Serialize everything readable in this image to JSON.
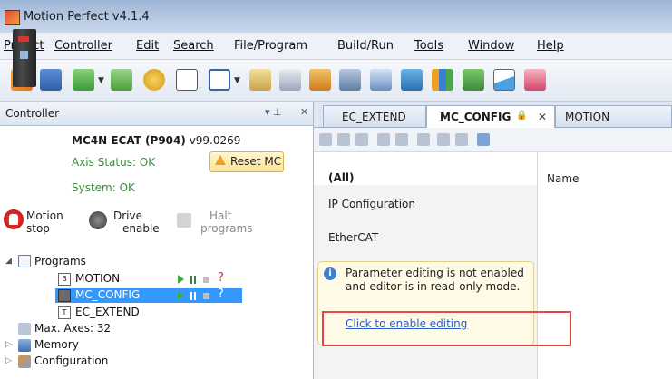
{
  "window": {
    "title": "Motion Perfect v4.1.4"
  },
  "menu": [
    "Project",
    "Controller",
    "Edit",
    "Search",
    "File/Program",
    "Build/Run",
    "Tools",
    "Window",
    "Help"
  ],
  "toolbar_icons": [
    "start-icon",
    "save-icon",
    "connect-icon",
    "dropdown-icon",
    "disconnect-icon",
    "debug-icon",
    "terminal-icon",
    "window-icon",
    "dropdown-icon",
    "axis-params-icon",
    "io-icon",
    "oscilloscope-icon",
    "jog-icon",
    "tools-icon",
    "image-icon",
    "bars-icon",
    "table-icon",
    "chart-icon",
    "grid-icon"
  ],
  "controller_panel": {
    "title": "Controller",
    "device": {
      "name": "MC4N ECAT (P904)",
      "version": "v99.0269"
    },
    "axis_status": "Axis Status: OK",
    "reset_label": "Reset MC",
    "system_status": "System: OK",
    "buttons": [
      {
        "line1": "Motion",
        "line2": "stop"
      },
      {
        "line1": "Drive",
        "line2": "enable"
      },
      {
        "line1": "Halt",
        "line2": "programs"
      }
    ],
    "tree": {
      "programs": "Programs",
      "items": [
        "MOTION",
        "MC_CONFIG",
        "EC_EXTEND"
      ],
      "q": "?",
      "max_axes": "Max. Axes: 32",
      "memory": "Memory",
      "configuration": "Configuration"
    }
  },
  "tabs": [
    {
      "label": "EC_EXTEND"
    },
    {
      "label": "MC_CONFIG",
      "active": true
    },
    {
      "label": "MOTION"
    }
  ],
  "editor": {
    "categories": [
      "(All)",
      "IP Configuration",
      "EtherCAT"
    ],
    "name_header": "Name",
    "notice_text": "Parameter editing is not enabled and editor is in read-only mode.",
    "notice_link": "Click to enable editing"
  }
}
